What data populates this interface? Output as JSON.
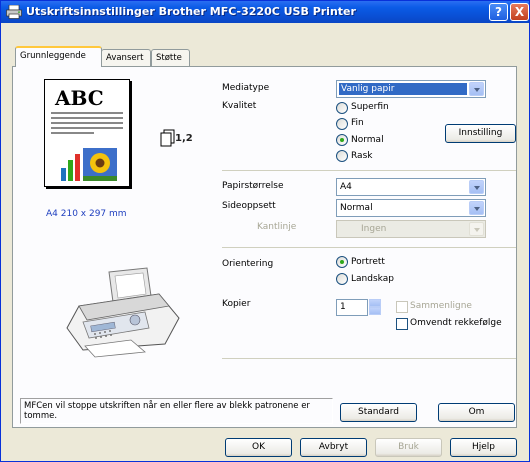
{
  "window": {
    "title": "Utskriftsinnstillinger Brother MFC-3220C USB Printer",
    "help_glyph": "?",
    "close_glyph": "X"
  },
  "tabs": [
    {
      "label": "Grunnleggende",
      "active": true
    },
    {
      "label": "Avansert",
      "active": false
    },
    {
      "label": "Støtte",
      "active": false
    }
  ],
  "preview": {
    "sample_text": "ABC",
    "copies_label": "1,2",
    "paper_size": "A4 210 x 297 mm"
  },
  "media": {
    "label": "Mediatype",
    "value": "Vanlig papir"
  },
  "quality": {
    "label": "Kvalitet",
    "options": [
      {
        "label": "Superfin",
        "selected": false
      },
      {
        "label": "Fin",
        "selected": false
      },
      {
        "label": "Normal",
        "selected": true
      },
      {
        "label": "Rask",
        "selected": false
      }
    ],
    "settings_button": "Innstilling"
  },
  "paper_size": {
    "label": "Papirstørrelse",
    "value": "A4"
  },
  "layout": {
    "label": "Sideoppsett",
    "value": "Normal"
  },
  "border": {
    "label": "Kantlinje",
    "value": "Ingen"
  },
  "orientation": {
    "label": "Orientering",
    "options": [
      {
        "label": "Portrett",
        "selected": true
      },
      {
        "label": "Landskap",
        "selected": false
      }
    ]
  },
  "copies": {
    "label": "Kopier",
    "value": "1",
    "collate_label": "Sammenligne",
    "reverse_label": "Omvendt rekkefølge"
  },
  "message": "MFCen vil stoppe utskriften når en eller flere av blekk patronene er tomme.",
  "buttons": {
    "standard": "Standard",
    "about": "Om",
    "ok": "OK",
    "cancel": "Avbryt",
    "apply": "Bruk",
    "help": "Hjelp"
  },
  "colors": {
    "titlebar": "#0a4fd4",
    "selection": "#316ac5",
    "paper_size_text": "#1f3fbf"
  }
}
